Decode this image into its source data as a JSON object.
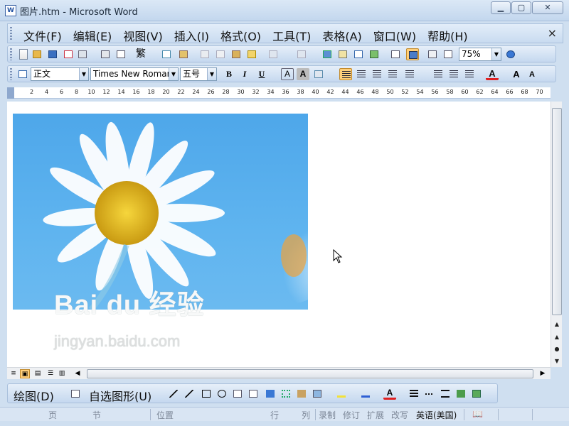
{
  "window": {
    "title": "图片.htm - Microsoft Word",
    "app_icon": "W"
  },
  "menubar": {
    "items": [
      "文件(F)",
      "编辑(E)",
      "视图(V)",
      "插入(I)",
      "格式(O)",
      "工具(T)",
      "表格(A)",
      "窗口(W)",
      "帮助(H)"
    ],
    "close_glyph": "×"
  },
  "standard_toolbar": {
    "zoom": "75%",
    "traditional_chinese": "繁"
  },
  "formatting_toolbar": {
    "style": "正文",
    "font": "Times New Roman",
    "size": "五号",
    "bold": "B",
    "italic": "I",
    "underline": "U",
    "char_border": "A",
    "char_shading": "A",
    "font_color": "A",
    "grow_font": "A",
    "shrink_font": "A"
  },
  "ruler": {
    "ticks": [
      "2",
      "4",
      "6",
      "8",
      "10",
      "12",
      "14",
      "16",
      "18",
      "20",
      "22",
      "24",
      "26",
      "28",
      "30",
      "32",
      "34",
      "36",
      "38",
      "40",
      "42",
      "44",
      "46",
      "48",
      "50",
      "52",
      "54",
      "56",
      "58",
      "60",
      "62",
      "64",
      "66",
      "68",
      "70"
    ]
  },
  "document": {
    "watermark": {
      "brand": "Bai du 经验",
      "url": "jingyan.baidu.com"
    }
  },
  "drawing_toolbar": {
    "draw": "绘图(D)",
    "autoshapes": "自选图形(U)"
  },
  "statusbar": {
    "page": "页",
    "section": "节",
    "position": "位置",
    "line": "行",
    "column": "列",
    "rec": "录制",
    "trk": "修订",
    "ext": "扩展",
    "ovr": "改写",
    "language": "英语(美国)"
  },
  "colors": {
    "accent": "#ffcf7a",
    "toolbar": "#c5d8ef",
    "sky": "#4ea7ea",
    "petal": "#ffffff",
    "center": "#e2b81a"
  }
}
